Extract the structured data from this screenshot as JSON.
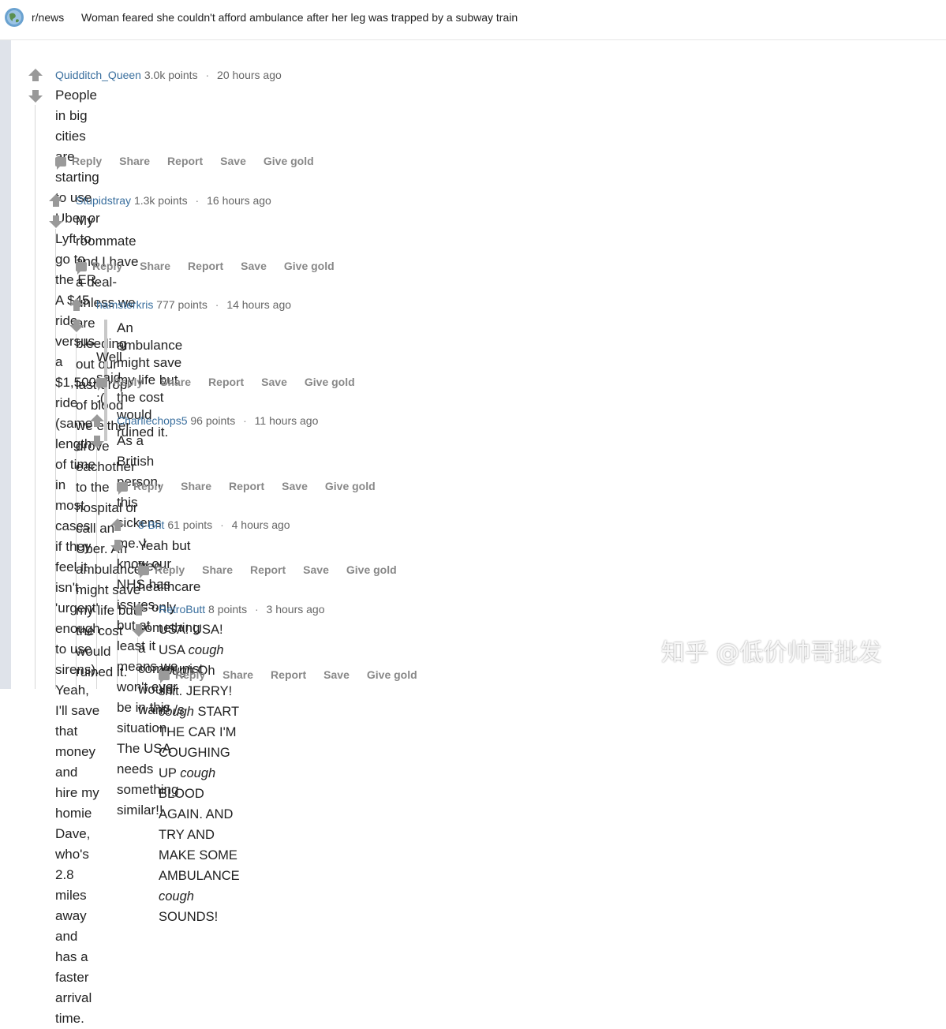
{
  "header": {
    "subreddit": "r/news",
    "title": "Woman feared she couldn't afford ambulance after her leg was trapped by a subway train"
  },
  "actions": {
    "reply": "Reply",
    "share": "Share",
    "report": "Report",
    "save": "Save",
    "give_gold": "Give gold"
  },
  "comments": [
    {
      "author": "Quidditch_Queen",
      "points": "3.0k points",
      "time": "20 hours ago",
      "lines": [
        "People in big cities are starting to use Uber or Lyft to go to the ER. A $45 ride versus a $1,500 ride (same length of time in",
        "most cases if they feel it isn't 'urgent' enough to use sirens). Yeah, I'll save that money and hire my homie Dave, who's 2.8",
        "miles away and has a faster arrival time."
      ]
    },
    {
      "author": "Stupidstray",
      "points": "1.3k points",
      "time": "16 hours ago",
      "lines": [
        "My roommate and I have a deal- unless we are bleeding out our last drop of blood we either drove eachother to the",
        "hospital or call an Uber. An ambulance might save my life but the cost would ruined it."
      ]
    },
    {
      "author": "hamsterkris",
      "points": "777 points",
      "time": "14 hours ago",
      "quote": "An ambulance might save my life but the cost would ruined it.",
      "lines": [
        "Well said. :("
      ]
    },
    {
      "author": "Charliechops5",
      "points": "96 points",
      "time": "11 hours ago",
      "lines": [
        "As a British person, this sickens me. I know our NHS has issues, but at least it means we won't ever be in this situation.",
        "The USA needs something similar!!"
      ]
    },
    {
      "author": "8-Brit",
      "points": "61 points",
      "time": "4 hours ago",
      "lines": [
        "Yeah but free healthcare is only something a communist would want! /s"
      ]
    },
    {
      "author": "RetroButt",
      "points": "8 points",
      "time": "3 hours ago",
      "line1": {
        "t1": "USA! USA! USA ",
        "i1": "cough cough",
        "t2": " Oh shit. JERRY! ",
        "i2": "cough",
        "t3": " START THE CAR I'M COUGHING UP ",
        "i3": "cough",
        "t4": " BLOOD AGAIN. AND TRY AND"
      },
      "line2": {
        "t1": "MAKE SOME AMBULANCE ",
        "i1": "cough",
        "t2": " SOUNDS!"
      }
    }
  ],
  "watermark": "知乎 @低价帅哥批发"
}
